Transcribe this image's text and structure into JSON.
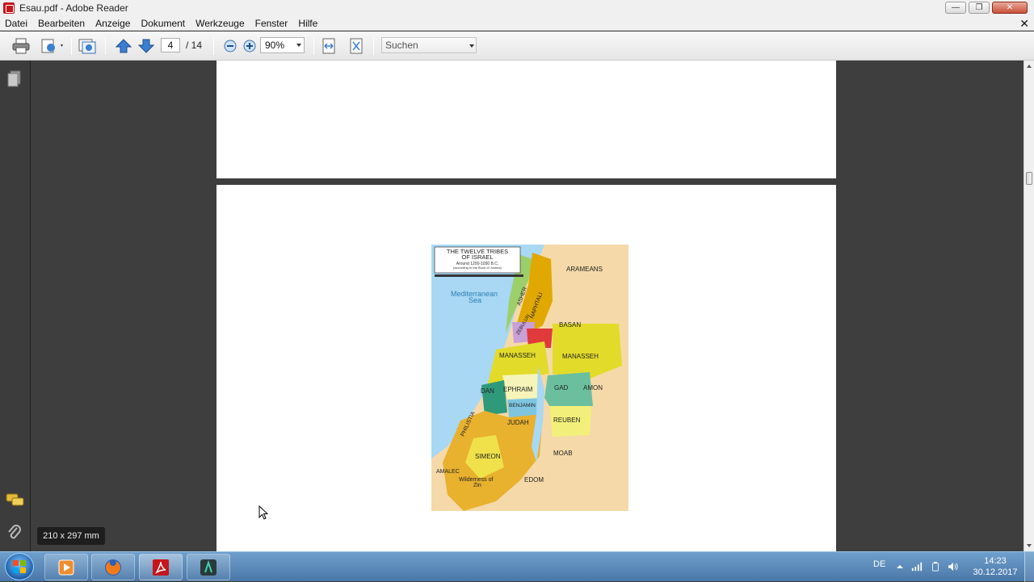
{
  "window": {
    "title": "Esau.pdf - Adobe Reader",
    "controls": {
      "minimize": "—",
      "maximize": "❐",
      "close": "✕"
    }
  },
  "menubar": {
    "items": [
      "Datei",
      "Bearbeiten",
      "Anzeige",
      "Dokument",
      "Werkzeuge",
      "Fenster",
      "Hilfe"
    ],
    "close_glyph": "✕"
  },
  "toolbar": {
    "page_current": "4",
    "page_total": "/ 14",
    "zoom": "90%",
    "search_placeholder": "Suchen"
  },
  "status": {
    "page_size": "210 x 297 mm"
  },
  "map": {
    "title_line1": "THE TWELVE TRIBES",
    "title_line2": "OF ISRAEL",
    "subtitle_line1": "Around 1200-1050 B.C.",
    "subtitle_line2": "(according to the Book of Joshua)",
    "labels": {
      "arameans": "ARAMEANS",
      "sea_line1": "Mediterranean",
      "sea_line2": "Sea",
      "asher": "ASHER",
      "naphtali": "NAPHTALI",
      "zebulun": "ZEBULUN",
      "basan": "BASAN",
      "manasseh_w": "MANASSEH",
      "manasseh_e": "MANASSEH",
      "gad": "GAD",
      "amon": "AMON",
      "ephraim": "EPHRAIM",
      "dan": "DAN",
      "benjamin": "BENJAMIN",
      "philistia": "PHILISTIA",
      "judah": "JUDAH",
      "reuben": "REUBEN",
      "moab": "MOAB",
      "simeon": "SIMEON",
      "amalec": "AMALEC",
      "edom": "EDOM",
      "wilderness_line1": "Wilderness of",
      "wilderness_line2": "Zin"
    }
  },
  "taskbar": {
    "language": "DE",
    "time": "14:23",
    "date": "30.12.2017"
  },
  "colors": {
    "sea": "#a8d8f4",
    "land": "#f5d9a8",
    "asher": "#9ccf6a",
    "naphtali": "#e0a800",
    "zebulun": "#c9a0d8",
    "issachar": "#e03a3a",
    "manasseh": "#e3db2a",
    "gad": "#6bbf9e",
    "ephraim": "#f6f4b8",
    "dan": "#2f9a7a",
    "benjamin": "#7fc5e0",
    "judah": "#e8b12e",
    "reuben": "#f2f07a",
    "simeon": "#f0e14a"
  }
}
